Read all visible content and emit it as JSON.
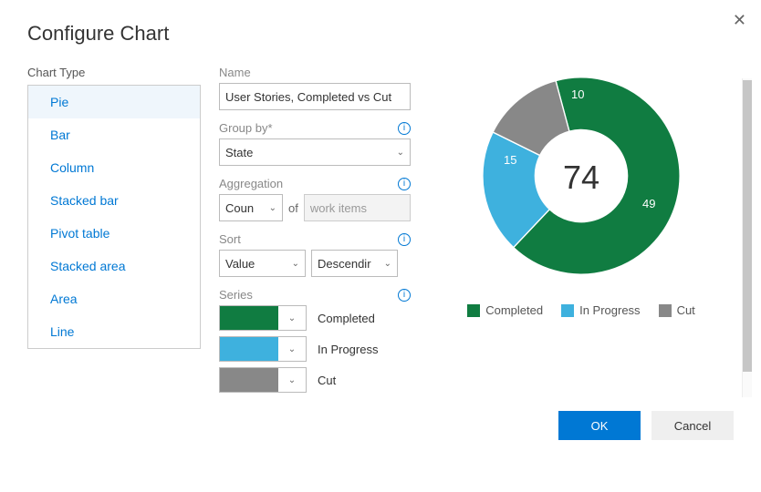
{
  "dialog": {
    "title": "Configure Chart",
    "ok_label": "OK",
    "cancel_label": "Cancel"
  },
  "chart_type": {
    "label": "Chart Type",
    "options": [
      "Pie",
      "Bar",
      "Column",
      "Stacked bar",
      "Pivot table",
      "Stacked area",
      "Area",
      "Line"
    ],
    "selected_index": 0
  },
  "config": {
    "name_label": "Name",
    "name_value": "User Stories, Completed vs Cut",
    "group_by_label": "Group by*",
    "group_by_value": "State",
    "aggregation_label": "Aggregation",
    "aggregation_value": "Coun",
    "of_label": "of",
    "of_placeholder": "work items",
    "sort_label": "Sort",
    "sort_field": "Value",
    "sort_direction": "Descendir",
    "series_label": "Series",
    "series": [
      {
        "label": "Completed",
        "color": "#107c41"
      },
      {
        "label": "In Progress",
        "color": "#3eb1de"
      },
      {
        "label": "Cut",
        "color": "#888888"
      }
    ]
  },
  "chart_data": {
    "type": "pie",
    "title": "",
    "total": 74,
    "categories": [
      "Completed",
      "In Progress",
      "Cut"
    ],
    "values": [
      49,
      15,
      10
    ],
    "series": [
      {
        "name": "Completed",
        "value": 49,
        "color": "#107c41"
      },
      {
        "name": "In Progress",
        "value": 15,
        "color": "#3eb1de"
      },
      {
        "name": "Cut",
        "value": 10,
        "color": "#888888"
      }
    ]
  }
}
